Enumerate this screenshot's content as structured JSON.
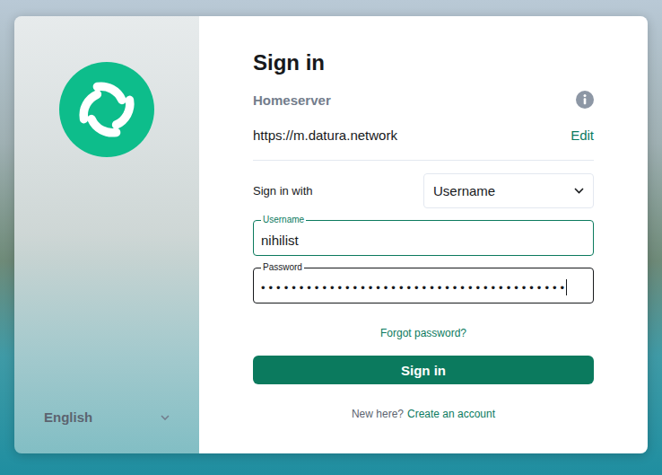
{
  "language": {
    "label": "English"
  },
  "form": {
    "title": "Sign in",
    "homeserver": {
      "label": "Homeserver",
      "url": "https://m.datura.network",
      "action": "Edit"
    },
    "sign_in_with": {
      "label": "Sign in with",
      "value": "Username"
    },
    "fields": [
      {
        "label": "Username",
        "value": "nihilist",
        "focused": false
      },
      {
        "label": "Password",
        "value": "••••••••••••••••••••••••••••••••••••••••",
        "focused": true
      }
    ],
    "forgot": "Forgot password?",
    "submit": "Sign in",
    "footer": {
      "prompt": "New here?",
      "link": "Create an account"
    }
  }
}
